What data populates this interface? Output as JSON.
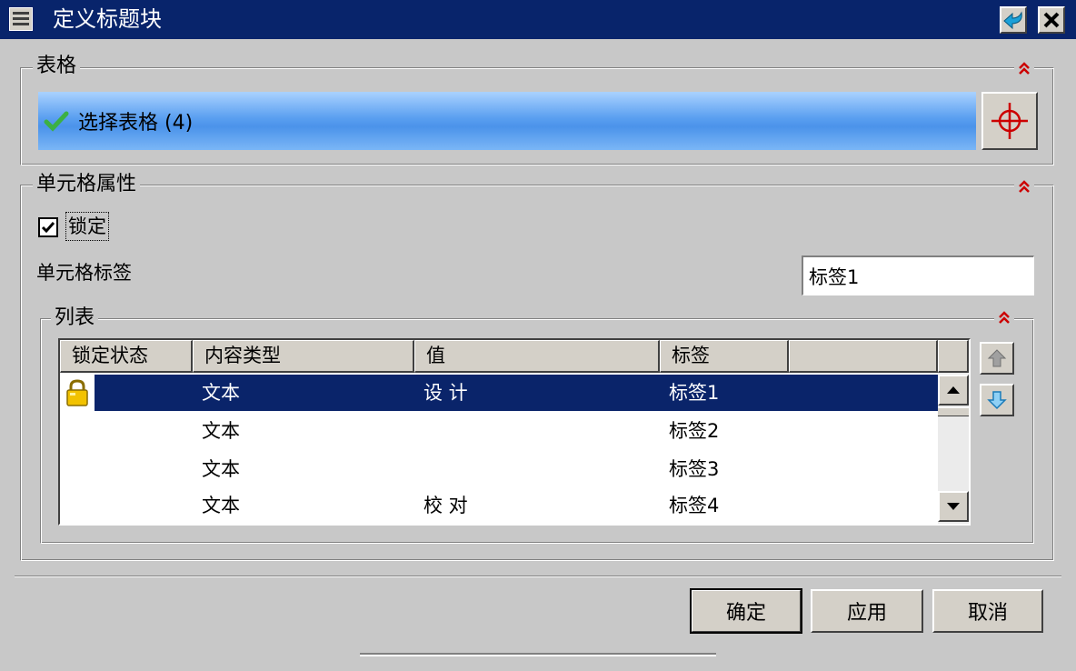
{
  "window": {
    "title": "定义标题块"
  },
  "table_section": {
    "title": "表格",
    "select_label": "选择表格 (4)"
  },
  "cell_props": {
    "title": "单元格属性",
    "lock_label": "锁定",
    "lock_checked": true,
    "cell_label_text": "单元格标签",
    "cell_label_value": "标签1"
  },
  "list_section": {
    "title": "列表",
    "columns": [
      "锁定状态",
      "内容类型",
      "值",
      "标签",
      ""
    ],
    "rows": [
      {
        "locked": true,
        "type": "文本",
        "value": "设 计",
        "label": "标签1",
        "selected": true
      },
      {
        "locked": false,
        "type": "文本",
        "value": "",
        "label": "标签2",
        "selected": false
      },
      {
        "locked": false,
        "type": "文本",
        "value": "",
        "label": "标签3",
        "selected": false
      },
      {
        "locked": false,
        "type": "文本",
        "value": "校 对",
        "label": "标签4",
        "selected": false
      }
    ]
  },
  "buttons": {
    "ok": "确定",
    "apply": "应用",
    "cancel": "取消"
  },
  "icons": {
    "system_menu": "system-menu-icon",
    "back": "back-arrow-icon",
    "close": "close-icon",
    "collapse": "collapse-chevron-icon",
    "check": "check-mark-icon",
    "crosshair": "crosshair-icon",
    "lock": "padlock-icon",
    "move_up": "arrow-up-icon",
    "move_down": "arrow-down-icon"
  },
  "colors": {
    "titlebar": "#08246b",
    "selection": "#0a246a",
    "select_bar": "#5a9ff0",
    "accent_red": "#cc0000",
    "check_green": "#3cb043"
  }
}
